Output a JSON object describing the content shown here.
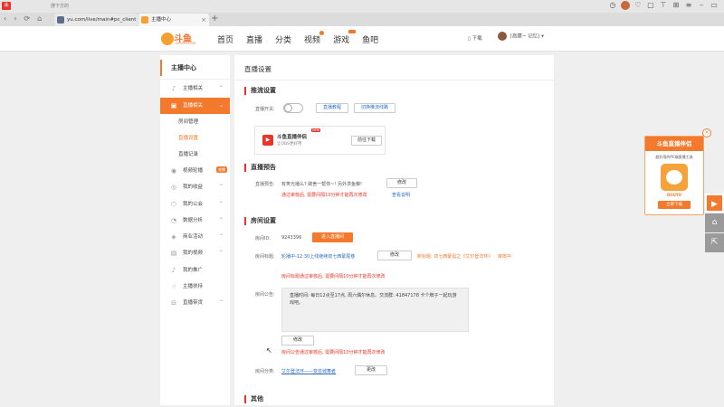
{
  "browser": {
    "logo_text": "斗",
    "search_hint": "搜下方的",
    "nav_icons": [
      "‹",
      "›",
      "⟳",
      "⌂"
    ],
    "tabs": [
      {
        "label": "yu.com/live/main#pc_client"
      },
      {
        "label": "主播中心"
      }
    ],
    "new_tab": "+",
    "close_glyph": "×"
  },
  "site": {
    "brand_name": "斗鱼",
    "brand_sub": "DOUYU.COM",
    "nav": [
      "首页",
      "直播",
      "分类",
      "视频",
      "游戏",
      "鱼吧"
    ],
    "download_label": "下载",
    "user_label": "[高建~ 记忆]"
  },
  "sidebar": {
    "title": "主播中心",
    "items": [
      {
        "label": "主播相关",
        "icon": "mic-icon"
      },
      {
        "label": "直播相关",
        "icon": "tv-icon"
      },
      {
        "label": "视频轮播",
        "icon": "play-icon",
        "badge": "来播"
      },
      {
        "label": "我的收益",
        "icon": "coin-icon"
      },
      {
        "label": "我的公会",
        "icon": "shield-icon"
      },
      {
        "label": "数据分析",
        "icon": "chart-icon"
      },
      {
        "label": "商业活动",
        "icon": "bag-icon"
      },
      {
        "label": "我的视频",
        "icon": "video-icon"
      },
      {
        "label": "我的推广",
        "icon": "mic-icon"
      },
      {
        "label": "主播扶持",
        "icon": "thumb-icon"
      },
      {
        "label": "直播带货",
        "icon": "cart-icon"
      }
    ],
    "sub_items": [
      "房间管理",
      "直播设置",
      "直播记录"
    ]
  },
  "panel": {
    "title": "直播设置",
    "stream": {
      "heading": "推流设置",
      "switch_label": "直播开关:",
      "tutorial_btn": "直播教程",
      "switch_line_btn": "切换推流线路"
    },
    "promo": {
      "title": "斗鱼直播伴侣",
      "subtitle": "让OBS更好用",
      "new_tag": "NEW",
      "button": "前往下载"
    },
    "preview": {
      "heading": "直播预告",
      "label": "直播预告:",
      "value": "有笑光播么? 跳舍一帮你~! 另外求鱼粮!",
      "edit_btn": "修改",
      "warn": "通过审核后, 需要间隔10分钟才能再次修改",
      "view_link": "查看说明"
    },
    "room": {
      "heading": "房间设置",
      "id_label": "房间ID:",
      "id_value": "9243396",
      "enter_btn": "进入直播间",
      "title_label": "房间标题:",
      "title_value": "轮播中-12:30上线继续双七西蒙尾巷",
      "title_edit": "修改",
      "new_title_label": "新标题:",
      "new_title_value": "双七西蒙鼠之《艾尔登法环》",
      "review_status": "审核中",
      "title_warn": "房间标题通过审核后, 需要间隔10分钟才能再次修改",
      "notice_label": "房间公告:",
      "notice_text": "直播时间: 每日12点至17点, 周六偶尔休息。交流群: 41847178 卡个牌子一起玩游戏吧。",
      "notice_edit": "修改",
      "notice_warn": "房间公告通过审核后, 需要间隔10分钟才能再次修改",
      "category_label": "房间分类:",
      "category_value": "艾尔登法环——变芸城舞者",
      "category_edit": "更改"
    },
    "other": {
      "heading": "其他"
    }
  },
  "float_ad": {
    "title": "斗鱼直播伴侣",
    "desc": "超好用的PC端直播工具",
    "app_name": "DOUYU",
    "download": "立即下载",
    "close": "×"
  },
  "side_tools": [
    "▶",
    "⌂",
    "⇱"
  ],
  "colors": {
    "accent": "#f37a2c",
    "warn": "#e8372a",
    "link": "#2f6fbf"
  }
}
